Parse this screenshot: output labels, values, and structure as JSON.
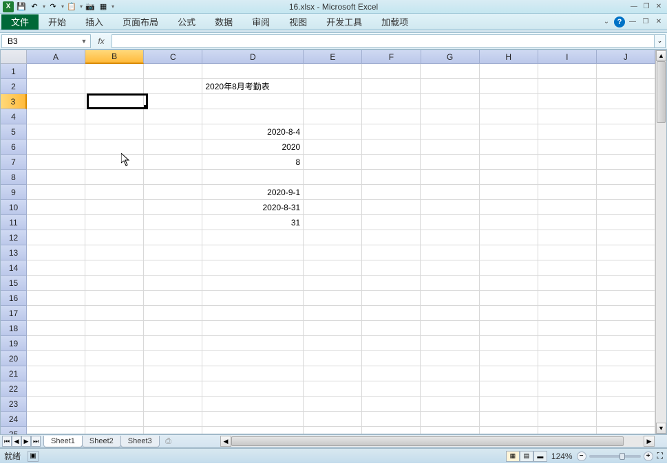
{
  "app": {
    "title": "16.xlsx - Microsoft Excel",
    "logo_letter": "X"
  },
  "qat": {
    "save": "💾",
    "undo": "↶",
    "redo": "↷",
    "camera": "📷",
    "other": "▦"
  },
  "window": {
    "min": "—",
    "restore": "❐",
    "close": "✕"
  },
  "ribbon": {
    "file": "文件",
    "tabs": [
      "开始",
      "插入",
      "页面布局",
      "公式",
      "数据",
      "审阅",
      "视图",
      "开发工具",
      "加载项"
    ],
    "help": "?",
    "caret": "⌄"
  },
  "formula_bar": {
    "name_box_value": "B3",
    "fx_label": "fx",
    "formula_value": ""
  },
  "columns": [
    "A",
    "B",
    "C",
    "D",
    "E",
    "F",
    "G",
    "H",
    "I",
    "J"
  ],
  "active_column_index": 1,
  "column_widths": {
    "D": "wide"
  },
  "row_count": 25,
  "active_row": 3,
  "cells": {
    "D2": {
      "value": "2020年8月考勤表",
      "align": "left"
    },
    "D5": {
      "value": "2020-8-4",
      "align": "right"
    },
    "D6": {
      "value": "2020",
      "align": "right"
    },
    "D7": {
      "value": "8",
      "align": "right"
    },
    "D9": {
      "value": "2020-9-1",
      "align": "right"
    },
    "D10": {
      "value": "2020-8-31",
      "align": "right"
    },
    "D11": {
      "value": "31",
      "align": "right"
    }
  },
  "active_cell": "B3",
  "sheet_tabs": {
    "items": [
      "Sheet1",
      "Sheet2",
      "Sheet3"
    ],
    "active_index": 0
  },
  "tab_nav": {
    "first": "⏮",
    "prev": "◀",
    "next": "▶",
    "last": "⏭"
  },
  "status": {
    "mode": "就绪",
    "macro_icon": "▣",
    "zoom_percent": "124%",
    "zoom_minus": "−",
    "zoom_plus": "+",
    "expand": "⛶"
  },
  "view_buttons": [
    "▦",
    "▤",
    "▬"
  ],
  "scroll": {
    "up": "▲",
    "down": "▼",
    "left": "◀",
    "right": "▶"
  }
}
